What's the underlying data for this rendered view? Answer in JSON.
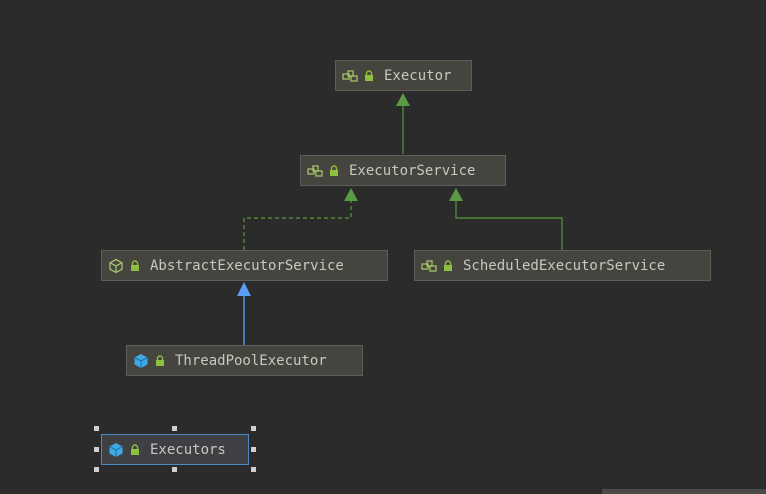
{
  "diagram": {
    "nodes": {
      "executor": {
        "label": "Executor",
        "kind": "interface"
      },
      "executor_service": {
        "label": "ExecutorService",
        "kind": "interface"
      },
      "abstract_executor_service": {
        "label": "AbstractExecutorService",
        "kind": "abstract-class"
      },
      "scheduled_executor_service": {
        "label": "ScheduledExecutorService",
        "kind": "interface"
      },
      "thread_pool_executor": {
        "label": "ThreadPoolExecutor",
        "kind": "class"
      },
      "executors": {
        "label": "Executors",
        "kind": "class",
        "selected": true
      }
    },
    "edges": [
      {
        "from": "executor_service",
        "to": "executor",
        "type": "extends",
        "style": "solid"
      },
      {
        "from": "abstract_executor_service",
        "to": "executor_service",
        "type": "implements",
        "style": "dashed"
      },
      {
        "from": "scheduled_executor_service",
        "to": "executor_service",
        "type": "extends",
        "style": "solid"
      },
      {
        "from": "thread_pool_executor",
        "to": "abstract_executor_service",
        "type": "extends-class",
        "style": "solid"
      }
    ]
  },
  "colors": {
    "background": "#2b2b2b",
    "node_fill": "#45443f",
    "node_border": "#5e5e58",
    "node_text": "#c8c8c0",
    "interface_icon": "#a4c46a",
    "class_icon": "#3fa9e8",
    "lock_icon": "#8fbf3f",
    "interface_edge": "#4f8a3a",
    "class_edge": "#589df6",
    "selection": "#4a88c7"
  },
  "icons": {
    "interface": "interface-icon",
    "abstract_class": "abstract-class-icon",
    "class": "class-icon",
    "lock": "lock-icon"
  }
}
